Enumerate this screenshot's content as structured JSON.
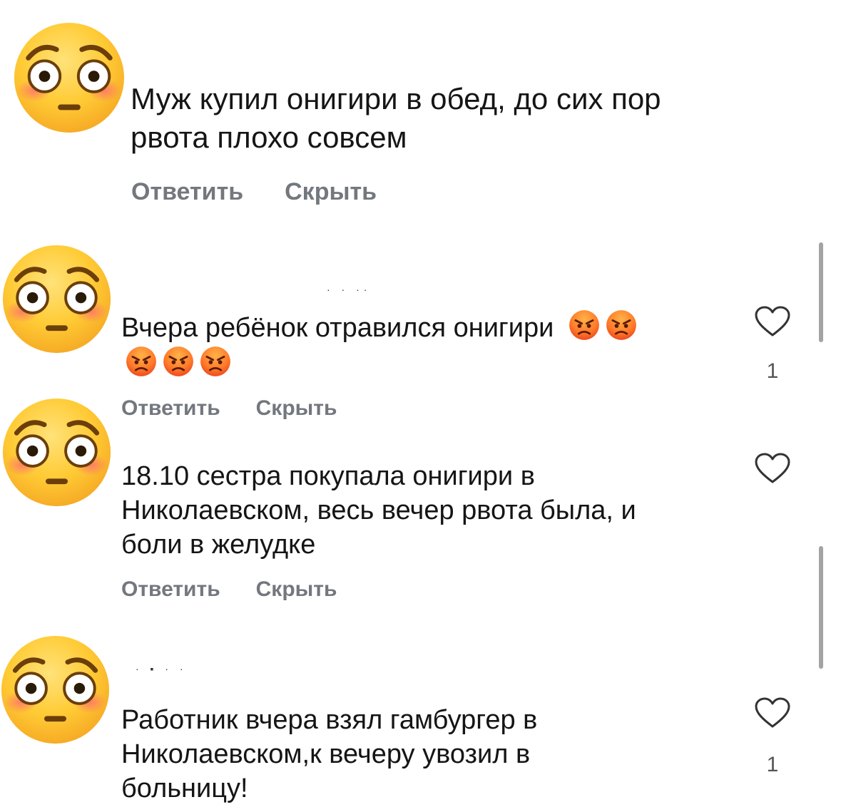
{
  "comments": [
    {
      "text_lines": [
        "Муж купил онигири в обед, до сих пор",
        "рвота плохо совсем"
      ],
      "reply_label": "Ответить",
      "hide_label": "Скрыть"
    },
    {
      "text_lines": [
        "Вчера ребёнок отравился онигири"
      ],
      "reply_label": "Ответить",
      "hide_label": "Скрыть",
      "like_count": "1"
    },
    {
      "text_lines": [
        "18.10 сестра покупала онигири в",
        "Николаевском, весь вечер рвота была, и",
        "боли в желудке"
      ],
      "reply_label": "Ответить",
      "hide_label": "Скрыть"
    },
    {
      "text_lines": [
        "Работник вчера взял гамбургер в",
        "Николаевском,к вечеру увозил в",
        "больницу!"
      ],
      "like_count": "1"
    }
  ],
  "icons": {
    "avatar": "flushed-face-emoji",
    "reaction": "angry-face-emoji",
    "like": "heart-outline-icon"
  },
  "colors": {
    "action_text": "#73777e",
    "scrollbar": "#a3a3a3",
    "emoji_yellow": "#ffcc33",
    "angry_orange": "#f25a1d"
  }
}
